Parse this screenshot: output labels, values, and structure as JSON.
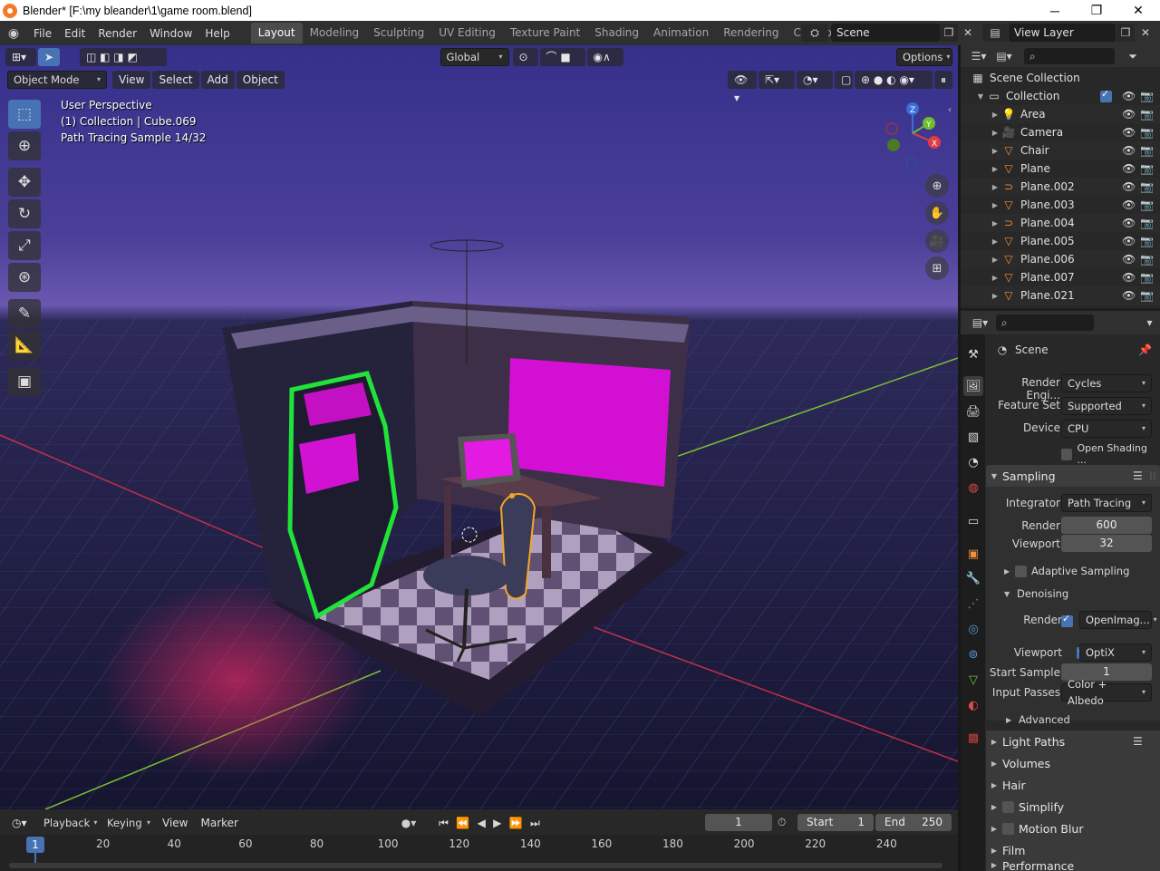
{
  "window": {
    "title": "Blender* [F:\\my bleander\\1\\game room.blend]",
    "minimize": "─",
    "maximize": "❐",
    "close": "✕"
  },
  "menu": [
    "File",
    "Edit",
    "Render",
    "Window",
    "Help"
  ],
  "workspaces": [
    "Layout",
    "Modeling",
    "Sculpting",
    "UV Editing",
    "Texture Paint",
    "Shading",
    "Animation",
    "Rendering",
    "Compositing"
  ],
  "active_workspace": "Layout",
  "scene_field": "Scene",
  "view_layer_field": "View Layer",
  "toolheader": {
    "transform_orientation": "Global",
    "options_label": "Options"
  },
  "viewport": {
    "mode": "Object Mode",
    "menus": [
      "View",
      "Select",
      "Add",
      "Object"
    ],
    "info_perspective": "User Perspective",
    "info_collection": "(1) Collection | Cube.069",
    "info_sample": "Path Tracing Sample 14/32",
    "gizmo": {
      "x": "X",
      "y": "Y",
      "z": "Z"
    }
  },
  "outliner": {
    "root": "Scene Collection",
    "collection": "Collection",
    "items": [
      {
        "name": "Area",
        "icon": "light-icon"
      },
      {
        "name": "Camera",
        "icon": "camera-icon"
      },
      {
        "name": "Chair",
        "icon": "mesh-icon"
      },
      {
        "name": "Plane",
        "icon": "mesh-icon"
      },
      {
        "name": "Plane.002",
        "icon": "curve-icon"
      },
      {
        "name": "Plane.003",
        "icon": "mesh-icon"
      },
      {
        "name": "Plane.004",
        "icon": "curve-icon"
      },
      {
        "name": "Plane.005",
        "icon": "mesh-icon"
      },
      {
        "name": "Plane.006",
        "icon": "mesh-icon"
      },
      {
        "name": "Plane.007",
        "icon": "mesh-icon"
      },
      {
        "name": "Plane.021",
        "icon": "mesh-icon"
      }
    ]
  },
  "properties": {
    "context": "Scene",
    "render_engine_label": "Render Engi...",
    "render_engine": "Cycles",
    "feature_set_label": "Feature Set",
    "feature_set": "Supported",
    "device_label": "Device",
    "device": "CPU",
    "open_shading": "Open Shading ...",
    "sampling_header": "Sampling",
    "integrator_label": "Integrator",
    "integrator": "Path Tracing",
    "render_label": "Render",
    "render_samples": "600",
    "viewport_label": "Viewport",
    "viewport_samples": "32",
    "adaptive_sampling": "Adaptive Sampling",
    "denoising_header": "Denoising",
    "denoise_render_label": "Render",
    "denoise_render_value": "OpenImag...",
    "denoise_viewport_label": "Viewport",
    "denoise_viewport_value": "OptiX",
    "start_sample_label": "Start Sample",
    "start_sample": "1",
    "input_passes_label": "Input Passes",
    "input_passes": "Color + Albedo",
    "advanced": "Advanced",
    "light_paths": "Light Paths",
    "volumes": "Volumes",
    "hair": "Hair",
    "simplify": "Simplify",
    "motion_blur": "Motion Blur",
    "film": "Film",
    "performance": "Performance"
  },
  "timeline": {
    "menus": [
      "Playback",
      "Keying",
      "View",
      "Marker"
    ],
    "current_frame": "1",
    "start_label": "Start",
    "start": "1",
    "end_label": "End",
    "end": "250",
    "ticks": [
      "20",
      "40",
      "60",
      "80",
      "100",
      "120",
      "140",
      "160",
      "180",
      "200",
      "220",
      "240"
    ],
    "playhead": "1"
  },
  "colors": {
    "accent": "#4772b3",
    "header": "#303030",
    "panel": "#282828",
    "selection_orange": "#f5a623"
  }
}
